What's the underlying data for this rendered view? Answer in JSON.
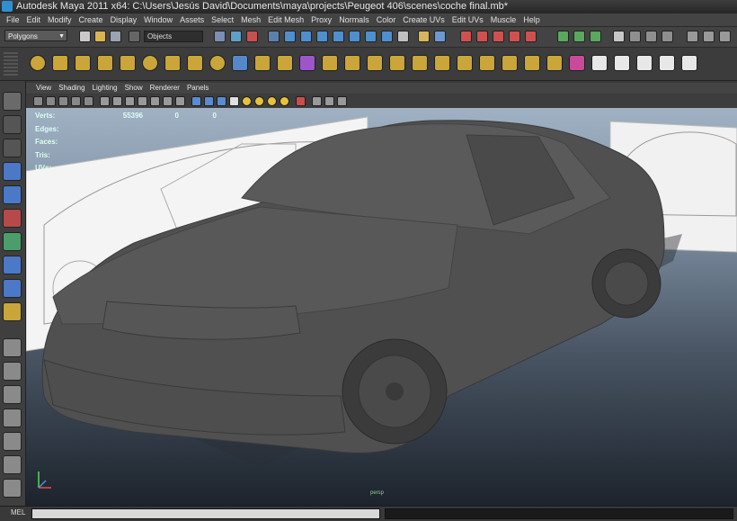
{
  "window": {
    "title": "Autodesk Maya 2011 x64: C:\\Users\\Jesús David\\Documents\\maya\\projects\\Peugeot 406\\scenes\\coche final.mb*"
  },
  "menu": [
    "File",
    "Edit",
    "Modify",
    "Create",
    "Display",
    "Window",
    "Assets",
    "Select",
    "Mesh",
    "Edit Mesh",
    "Proxy",
    "Normals",
    "Color",
    "Create UVs",
    "Edit UVs",
    "Muscle",
    "Help"
  ],
  "status_line": {
    "mode": "Polygons",
    "selection_field": "Objects"
  },
  "panel_menu": [
    "View",
    "Shading",
    "Lighting",
    "Show",
    "Renderer",
    "Panels"
  ],
  "hud": {
    "verts_label": "Verts:",
    "verts": [
      "55396",
      "0",
      "0"
    ],
    "edges_label": "Edges:",
    "faces_label": "Faces:",
    "tris_label": "Tris:",
    "uvs_label": "UVs:"
  },
  "camera_label": "persp",
  "command_line": {
    "language": "MEL"
  },
  "colors": {
    "accent": "#2f8fd0",
    "hud_text": "#dfe",
    "viewport_top": "#9fb1c3",
    "viewport_bottom": "#1c232c"
  }
}
